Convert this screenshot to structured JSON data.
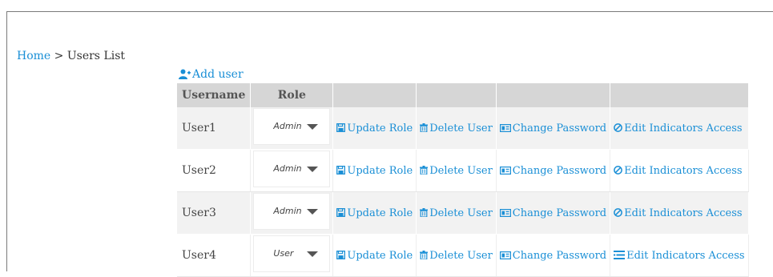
{
  "breadcrumb": {
    "home": "Home",
    "separator": " > ",
    "current": "Users List"
  },
  "add_user_label": "Add user",
  "table": {
    "headers": [
      "Username",
      "Role",
      "",
      "",
      "",
      ""
    ],
    "actions": {
      "update_role": "Update Role",
      "delete_user": "Delete User",
      "change_password": "Change Password",
      "edit_access": "Edit Indicators Access"
    },
    "rows": [
      {
        "username": "User1",
        "role": "Admin"
      },
      {
        "username": "User2",
        "role": "Admin"
      },
      {
        "username": "User3",
        "role": "Admin"
      },
      {
        "username": "User4",
        "role": "User"
      }
    ]
  },
  "colors": {
    "link": "#1a8fd6",
    "header_bg": "#d6d6d6",
    "row_alt": "#f2f2f2"
  },
  "icons": [
    "user-plus-icon",
    "save-icon",
    "trash-icon",
    "id-card-icon",
    "ban-icon",
    "list-icon"
  ]
}
